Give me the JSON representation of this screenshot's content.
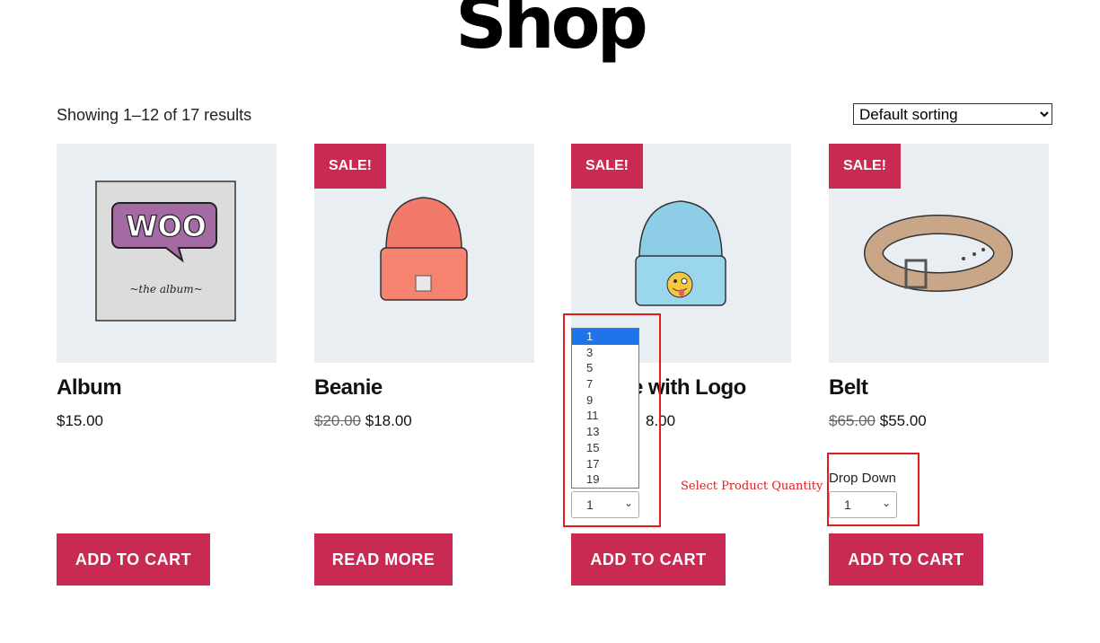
{
  "page": {
    "title": "Shop"
  },
  "toolbar": {
    "result_count": "Showing 1–12 of 17 results",
    "sorting_selected": "Default sorting"
  },
  "products": [
    {
      "name": "Album",
      "regular_price": "",
      "price": "$15.00",
      "sale_badge": "",
      "button": "ADD TO CART"
    },
    {
      "name": "Beanie",
      "regular_price": "$20.00",
      "price": "$18.00",
      "sale_badge": "SALE!",
      "button": "READ MORE"
    },
    {
      "name": "Beanie with Logo",
      "name_visible": "e with Logo",
      "price_visible": "8.00",
      "sale_badge": "SALE!",
      "button": "ADD TO CART",
      "quantity_selected": "1"
    },
    {
      "name": "Belt",
      "regular_price": "$65.00",
      "price": "$55.00",
      "sale_badge": "SALE!",
      "button": "ADD TO CART",
      "quantity_label": "Drop Down",
      "quantity_selected": "1"
    }
  ],
  "quantity_dropdown": {
    "options": [
      "1",
      "3",
      "5",
      "7",
      "9",
      "11",
      "13",
      "15",
      "17",
      "19"
    ],
    "selected_index": 0
  },
  "annotation": {
    "text": "Select Product Quantity",
    "highlight_color": "#e31b1b"
  },
  "colors": {
    "accent": "#c92a52",
    "image_bg": "#e8eef2",
    "dropdown_highlight": "#1e74e8"
  },
  "images": {
    "album_text_top": "WOO",
    "album_text_bottom": "~the   album~"
  },
  "icons": {
    "select_chevron": "chevron-down-icon"
  }
}
